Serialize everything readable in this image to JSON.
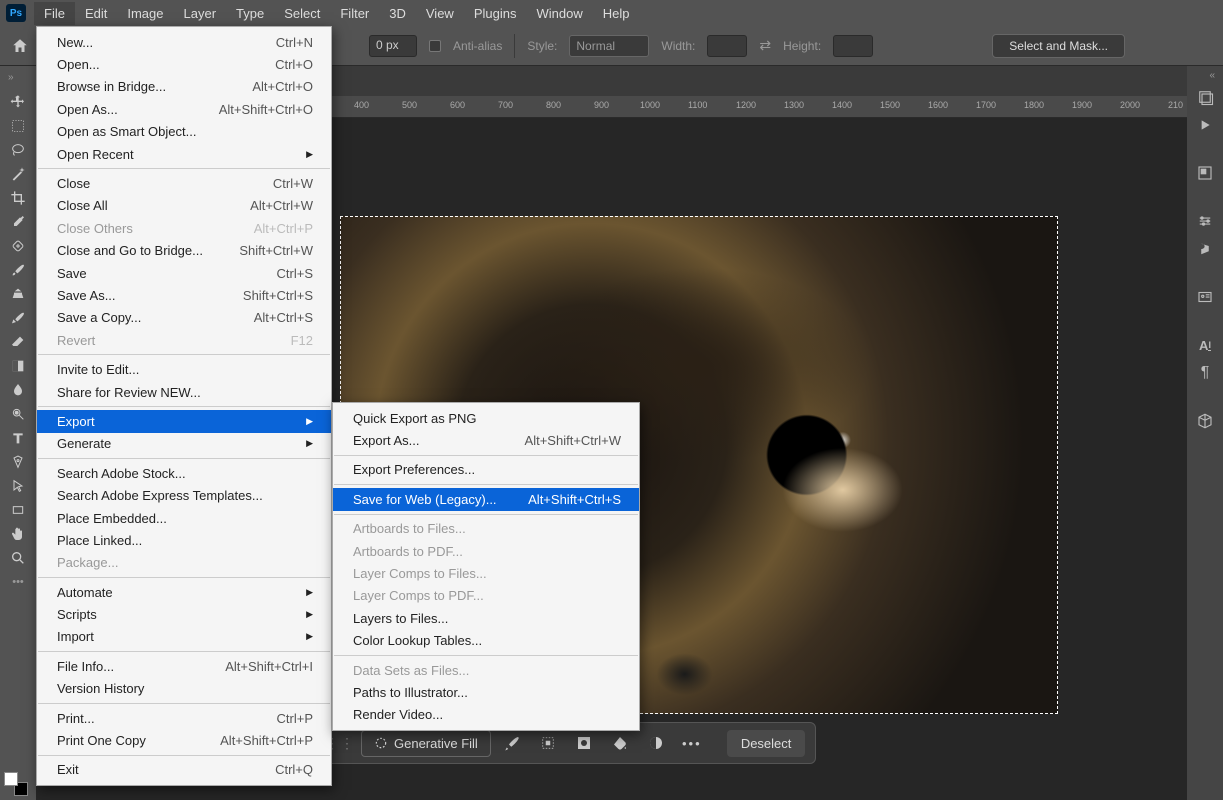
{
  "menubar": {
    "items": [
      "File",
      "Edit",
      "Image",
      "Layer",
      "Type",
      "Select",
      "Filter",
      "3D",
      "View",
      "Plugins",
      "Window",
      "Help"
    ],
    "logo": "Ps"
  },
  "options": {
    "feather_label": "0 px",
    "antialias": "Anti-alias",
    "style_label": "Style:",
    "style_value": "Normal",
    "width_label": "Width:",
    "height_label": "Height:",
    "mask_btn": "Select and Mask..."
  },
  "ruler_marks": [
    "400",
    "500",
    "600",
    "700",
    "800",
    "900",
    "1000",
    "1100",
    "1200",
    "1300",
    "1400",
    "1500",
    "1600",
    "1700",
    "1800",
    "1900",
    "2000",
    "210"
  ],
  "taskbar": {
    "gen_fill": "Generative Fill",
    "deselect": "Deselect"
  },
  "file_menu": [
    {
      "label": "New...",
      "sc": "Ctrl+N"
    },
    {
      "label": "Open...",
      "sc": "Ctrl+O"
    },
    {
      "label": "Browse in Bridge...",
      "sc": "Alt+Ctrl+O"
    },
    {
      "label": "Open As...",
      "sc": "Alt+Shift+Ctrl+O"
    },
    {
      "label": "Open as Smart Object..."
    },
    {
      "label": "Open Recent",
      "sub": true
    },
    {
      "sep": true
    },
    {
      "label": "Close",
      "sc": "Ctrl+W"
    },
    {
      "label": "Close All",
      "sc": "Alt+Ctrl+W"
    },
    {
      "label": "Close Others",
      "sc": "Alt+Ctrl+P",
      "dis": true
    },
    {
      "label": "Close and Go to Bridge...",
      "sc": "Shift+Ctrl+W"
    },
    {
      "label": "Save",
      "sc": "Ctrl+S"
    },
    {
      "label": "Save As...",
      "sc": "Shift+Ctrl+S"
    },
    {
      "label": "Save a Copy...",
      "sc": "Alt+Ctrl+S"
    },
    {
      "label": "Revert",
      "sc": "F12",
      "dis": true
    },
    {
      "sep": true
    },
    {
      "label": "Invite to Edit..."
    },
    {
      "label": "Share for Review NEW..."
    },
    {
      "sep": true
    },
    {
      "label": "Export",
      "sub": true,
      "hl": true
    },
    {
      "label": "Generate",
      "sub": true
    },
    {
      "sep": true
    },
    {
      "label": "Search Adobe Stock..."
    },
    {
      "label": "Search Adobe Express Templates..."
    },
    {
      "label": "Place Embedded..."
    },
    {
      "label": "Place Linked..."
    },
    {
      "label": "Package...",
      "dis": true
    },
    {
      "sep": true
    },
    {
      "label": "Automate",
      "sub": true
    },
    {
      "label": "Scripts",
      "sub": true
    },
    {
      "label": "Import",
      "sub": true
    },
    {
      "sep": true
    },
    {
      "label": "File Info...",
      "sc": "Alt+Shift+Ctrl+I"
    },
    {
      "label": "Version History"
    },
    {
      "sep": true
    },
    {
      "label": "Print...",
      "sc": "Ctrl+P"
    },
    {
      "label": "Print One Copy",
      "sc": "Alt+Shift+Ctrl+P"
    },
    {
      "sep": true
    },
    {
      "label": "Exit",
      "sc": "Ctrl+Q"
    }
  ],
  "export_menu": [
    {
      "label": "Quick Export as PNG"
    },
    {
      "label": "Export As...",
      "sc": "Alt+Shift+Ctrl+W"
    },
    {
      "sep": true
    },
    {
      "label": "Export Preferences..."
    },
    {
      "sep": true
    },
    {
      "label": "Save for Web (Legacy)...",
      "sc": "Alt+Shift+Ctrl+S",
      "hl": true
    },
    {
      "sep": true
    },
    {
      "label": "Artboards to Files...",
      "dis": true
    },
    {
      "label": "Artboards to PDF...",
      "dis": true
    },
    {
      "label": "Layer Comps to Files...",
      "dis": true
    },
    {
      "label": "Layer Comps to PDF...",
      "dis": true
    },
    {
      "label": "Layers to Files..."
    },
    {
      "label": "Color Lookup Tables..."
    },
    {
      "sep": true
    },
    {
      "label": "Data Sets as Files...",
      "dis": true
    },
    {
      "label": "Paths to Illustrator..."
    },
    {
      "label": "Render Video..."
    }
  ]
}
